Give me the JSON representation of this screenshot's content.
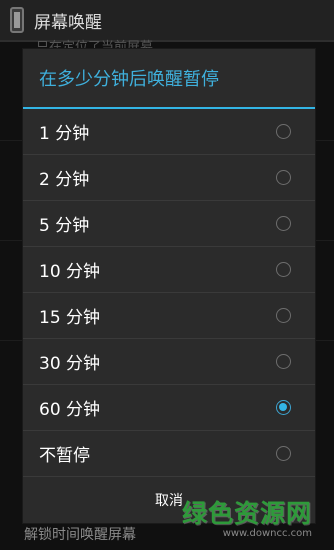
{
  "action_bar": {
    "title": "屏幕唤醒"
  },
  "background": {
    "peek_text": "只在定位了当前屏幕",
    "bottom_text": "解锁时间唤醒屏幕"
  },
  "dialog": {
    "title": "在多少分钟后唤醒暂停",
    "options": [
      {
        "label": "1 分钟",
        "selected": false
      },
      {
        "label": "2 分钟",
        "selected": false
      },
      {
        "label": "5 分钟",
        "selected": false
      },
      {
        "label": "10 分钟",
        "selected": false
      },
      {
        "label": "15 分钟",
        "selected": false
      },
      {
        "label": "30 分钟",
        "selected": false
      },
      {
        "label": "60 分钟",
        "selected": true
      },
      {
        "label": "不暂停",
        "selected": false
      }
    ],
    "cancel_label": "取消"
  },
  "watermark": {
    "main": "绿色资源网",
    "sub": "www.downcc.com"
  },
  "colors": {
    "accent": "#33b5e5",
    "title_text": "#3fb0dc",
    "dialog_bg": "#2b2b2b"
  }
}
